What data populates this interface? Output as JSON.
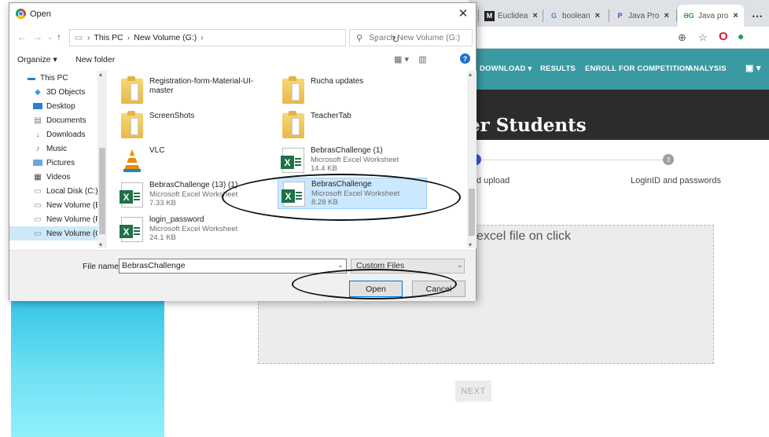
{
  "browser": {
    "tabs": [
      {
        "icon": "M",
        "label": "Euclidea",
        "close": "×"
      },
      {
        "icon": "G",
        "label": "boolean",
        "close": "×"
      },
      {
        "icon": "P",
        "label": "Java Pro",
        "close": "×"
      },
      {
        "icon": "ƏG",
        "label": "Java pro",
        "close": "×"
      }
    ],
    "overflow_icon": "⋯"
  },
  "site": {
    "nav": [
      "DOWNLOAD ▾",
      "RESULTS",
      "ENROLL FOR COMPETITION",
      "ANALYSIS"
    ],
    "title": "er Students",
    "step2_label": "d upload",
    "step3_number": "3",
    "step3_label": "LoginID and passwords",
    "dropzone_text": "excel file on click",
    "next_label": "NEXT"
  },
  "dialog": {
    "title": "Open",
    "close": "✕",
    "breadcrumb": [
      "This PC",
      "New Volume (G:)"
    ],
    "search_placeholder": "Search New Volume (G:)",
    "commands": {
      "organize": "Organize ▾",
      "new_folder": "New folder"
    },
    "help": "?",
    "nav_items": [
      {
        "label": "This PC",
        "icon": "pc-icon"
      },
      {
        "label": "3D Objects",
        "icon": "cube-icon"
      },
      {
        "label": "Desktop",
        "icon": "desktop-icon"
      },
      {
        "label": "Documents",
        "icon": "documents-icon"
      },
      {
        "label": "Downloads",
        "icon": "downloads-icon"
      },
      {
        "label": "Music",
        "icon": "music-icon"
      },
      {
        "label": "Pictures",
        "icon": "pictures-icon"
      },
      {
        "label": "Videos",
        "icon": "videos-icon"
      },
      {
        "label": "Local Disk (C:)",
        "icon": "disk-icon"
      },
      {
        "label": "New Volume (E:)",
        "icon": "drive-icon"
      },
      {
        "label": "New Volume (F:)",
        "icon": "drive-icon"
      },
      {
        "label": "New Volume (G:)",
        "icon": "drive-icon"
      }
    ],
    "files": [
      {
        "name": "Registration-form-Material-UI-master",
        "type": "",
        "size": "",
        "icon": "folder"
      },
      {
        "name": "Rucha updates",
        "type": "",
        "size": "",
        "icon": "folder"
      },
      {
        "name": "ScreenShots",
        "type": "",
        "size": "",
        "icon": "folder"
      },
      {
        "name": "TeacherTab",
        "type": "",
        "size": "",
        "icon": "folder"
      },
      {
        "name": "VLC",
        "type": "",
        "size": "",
        "icon": "vlc"
      },
      {
        "name": "BebrasChallenge (1)",
        "type": "Microsoft Excel Worksheet",
        "size": "14.4 KB",
        "icon": "xls"
      },
      {
        "name": "BebrasChallenge (13) (1)",
        "type": "Microsoft Excel Worksheet",
        "size": "7.33 KB",
        "icon": "xls"
      },
      {
        "name": "BebrasChallenge",
        "type": "Microsoft Excel Worksheet",
        "size": "8.28 KB",
        "icon": "xls"
      },
      {
        "name": "login_password",
        "type": "Microsoft Excel Worksheet",
        "size": "24.1 KB",
        "icon": "xls"
      }
    ],
    "file_name_label": "File name:",
    "file_name_value": "BebrasChallenge",
    "file_type": "Custom Files",
    "open_label": "Open",
    "cancel_label": "Cancel"
  }
}
